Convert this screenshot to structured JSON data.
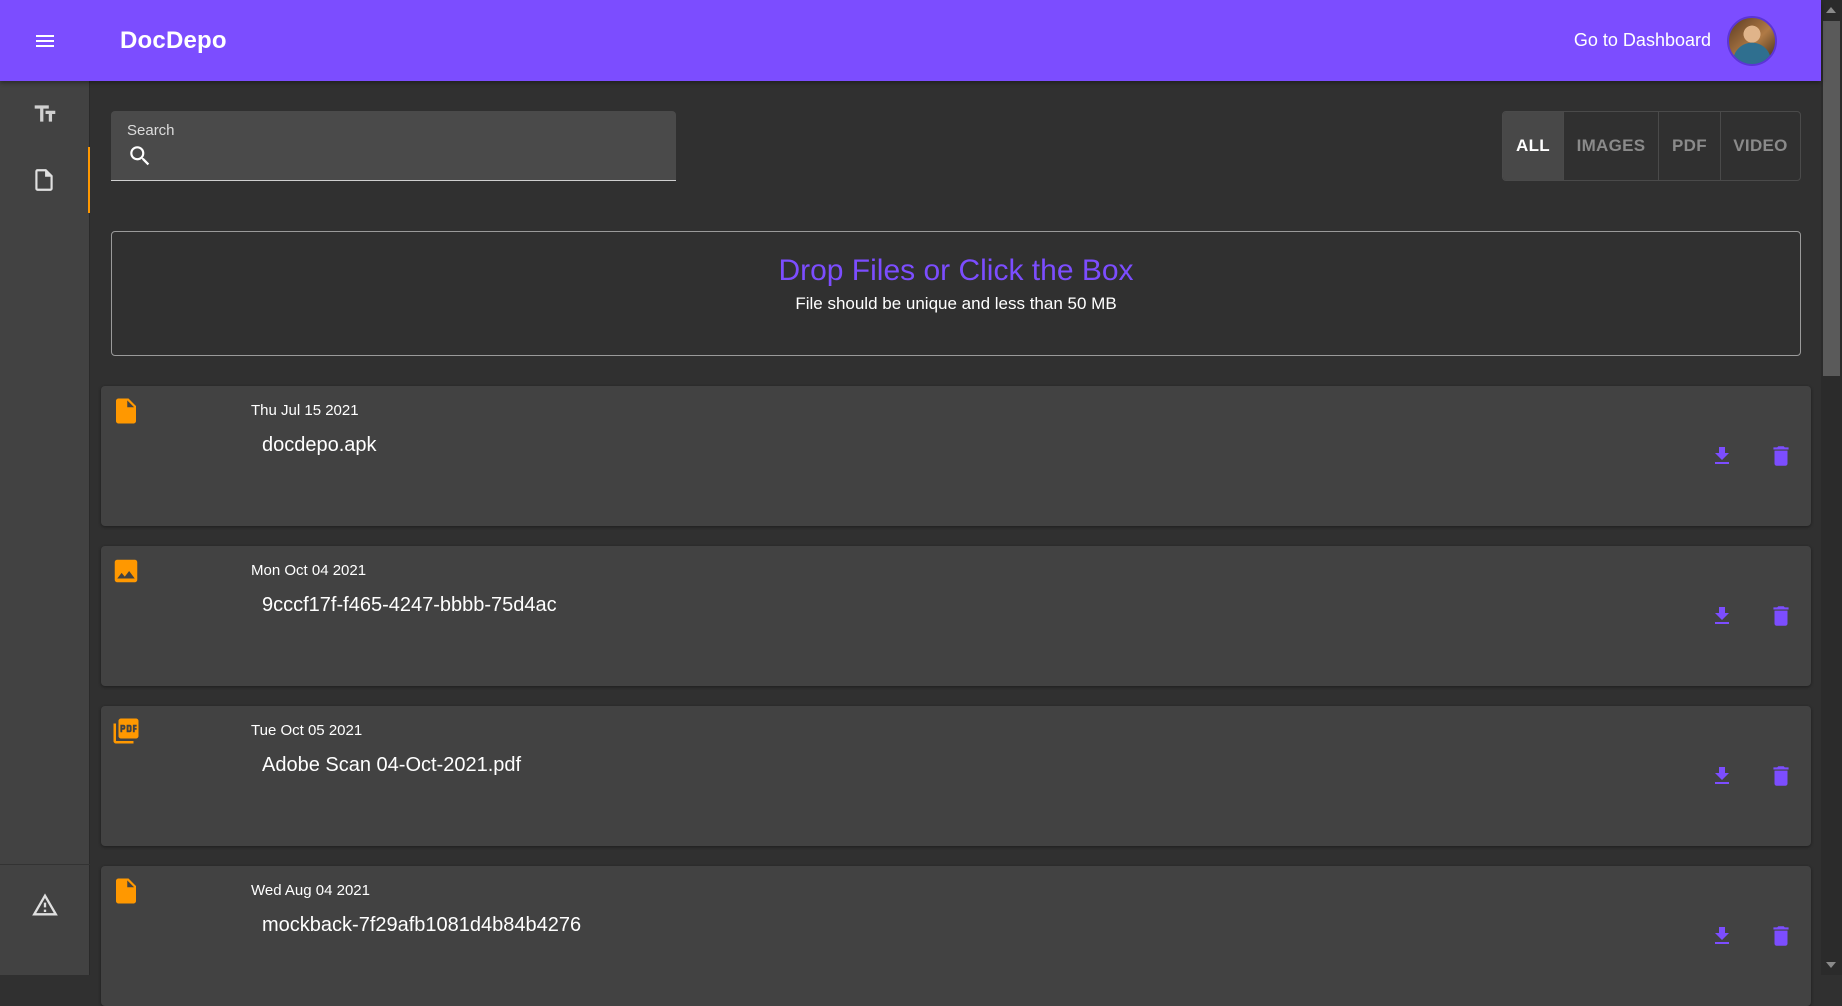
{
  "appbar": {
    "title": "DocDepo",
    "dashboard_link": "Go to Dashboard"
  },
  "sidebar": {
    "items": [
      {
        "icon": "text-fields-icon"
      },
      {
        "icon": "file-icon",
        "active": true
      }
    ],
    "bottom_icon": "warning-icon"
  },
  "search": {
    "label": "Search",
    "value": ""
  },
  "filters": {
    "options": [
      "ALL",
      "IMAGES",
      "PDF",
      "VIDEO"
    ],
    "selected": "ALL"
  },
  "dropzone": {
    "title": "Drop Files or Click the Box",
    "subtitle": "File should be unique and less than 50 MB"
  },
  "files": [
    {
      "date": "Thu Jul 15 2021",
      "name": "docdepo.apk",
      "type_icon": "file-icon"
    },
    {
      "date": "Mon Oct 04 2021",
      "name": "9cccf17f-f465-4247-bbbb-75d4ac",
      "type_icon": "image-icon"
    },
    {
      "date": "Tue Oct 05 2021",
      "name": "Adobe Scan 04-Oct-2021.pdf",
      "type_icon": "pdf-icon"
    },
    {
      "date": "Wed Aug 04 2021",
      "name": "mockback-7f29afb1081d4b84b4276",
      "type_icon": "file-icon"
    }
  ],
  "colors": {
    "primary": "#7c4dff",
    "accent": "#ff9800",
    "background": "#303030",
    "card": "#424242"
  }
}
